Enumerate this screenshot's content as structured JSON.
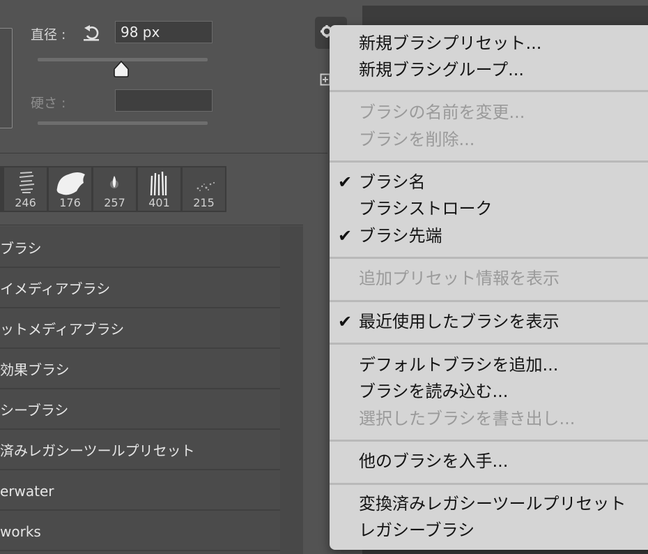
{
  "panel": {
    "diameter_label": "直径 :",
    "diameter_value": "98 px",
    "hardness_label": "硬さ :",
    "diameter_slider_level": 0.49
  },
  "tiles": [
    {
      "num": "246"
    },
    {
      "num": "176"
    },
    {
      "num": "257"
    },
    {
      "num": "401"
    },
    {
      "num": "215"
    }
  ],
  "list": {
    "items": [
      "ブラシ",
      "イメディアブラシ",
      "ットメディアブラシ",
      "効果ブラシ",
      "シーブラシ",
      "済みレガシーツールプリセット",
      "erwater",
      "works"
    ]
  },
  "menu": {
    "items": [
      {
        "label": "新規ブラシプリセット...",
        "enabled": true,
        "checked": false
      },
      {
        "label": "新規ブラシグループ...",
        "enabled": true,
        "checked": false
      },
      {
        "label": "ブラシの名前を変更...",
        "enabled": false,
        "checked": false
      },
      {
        "label": "ブラシを削除...",
        "enabled": false,
        "checked": false
      },
      {
        "label": "ブラシ名",
        "enabled": true,
        "checked": true
      },
      {
        "label": "ブラシストローク",
        "enabled": true,
        "checked": false
      },
      {
        "label": "ブラシ先端",
        "enabled": true,
        "checked": true
      },
      {
        "label": "追加プリセット情報を表示",
        "enabled": false,
        "checked": false
      },
      {
        "label": "最近使用したブラシを表示",
        "enabled": true,
        "checked": true
      },
      {
        "label": "デフォルトブラシを追加...",
        "enabled": true,
        "checked": false
      },
      {
        "label": "ブラシを読み込む...",
        "enabled": true,
        "checked": false
      },
      {
        "label": "選択したブラシを書き出し...",
        "enabled": false,
        "checked": false
      },
      {
        "label": "他のブラシを入手...",
        "enabled": true,
        "checked": false
      },
      {
        "label": "変換済みレガシーツールプリセット",
        "enabled": true,
        "checked": false
      },
      {
        "label": "レガシーブラシ",
        "enabled": true,
        "checked": false
      }
    ],
    "check_glyph": "✔"
  },
  "icons": {
    "reset": "reset-icon",
    "gear": "gear-icon",
    "new-brush": "new-brush-icon"
  }
}
